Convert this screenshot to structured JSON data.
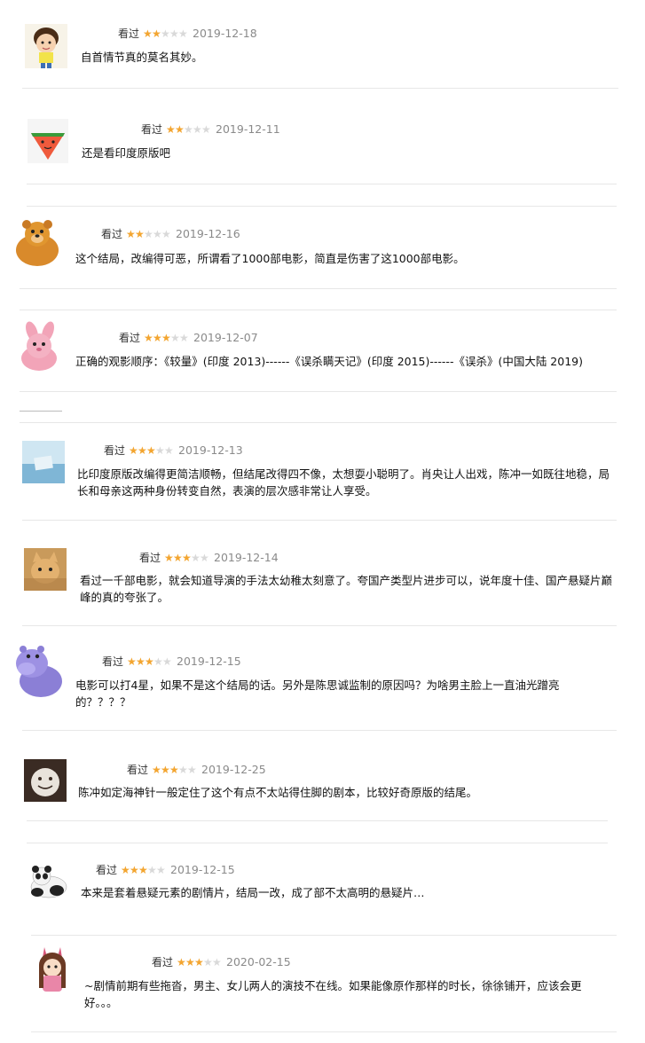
{
  "reviews": [
    {
      "status": "看过",
      "rating": 2,
      "date": "2019-12-18",
      "text": "自首情节真的莫名其妙。"
    },
    {
      "status": "看过",
      "rating": 2,
      "date": "2019-12-11",
      "text": "还是看印度原版吧"
    },
    {
      "status": "看过",
      "rating": 2,
      "date": "2019-12-16",
      "text": "这个结局，改编得可恶，所谓看了1000部电影，简直是伤害了这1000部电影。"
    },
    {
      "status": "看过",
      "rating": 3,
      "date": "2019-12-07",
      "text": "正确的观影顺序：《较量》(印度 2013)------《误杀瞒天记》(印度 2015)------《误杀》(中国大陆 2019)"
    },
    {
      "status": "看过",
      "rating": 3,
      "date": "2019-12-13",
      "text": "比印度原版改编得更简洁顺畅，但结尾改得四不像，太想耍小聪明了。肖央让人出戏，陈冲一如既往地稳，局长和母亲这两种身份转变自然，表演的层次感非常让人享受。"
    },
    {
      "status": "看过",
      "rating": 3,
      "date": "2019-12-14",
      "text": "看过一千部电影，就会知道导演的手法太幼稚太刻意了。夸国产类型片进步可以，说年度十佳、国产悬疑片巅峰的真的夸张了。"
    },
    {
      "status": "看过",
      "rating": 3,
      "date": "2019-12-15",
      "text": "电影可以打4星，如果不是这个结局的话。另外是陈思诚监制的原因吗？为啥男主脸上一直油光蹭亮的？？？？"
    },
    {
      "status": "看过",
      "rating": 3,
      "date": "2019-12-25",
      "text": "陈冲如定海神针一般定住了这个有点不太站得住脚的剧本，比较好奇原版的结尾。"
    },
    {
      "status": "看过",
      "rating": 3,
      "date": "2019-12-15",
      "text": "本来是套着悬疑元素的剧情片，结局一改，成了部不太高明的悬疑片…"
    },
    {
      "status": "看过",
      "rating": 3,
      "date": "2020-02-15",
      "text": "~剧情前期有些拖沓，男主、女儿两人的演技不在线。如果能像原作那样的时长，徐徐铺开，应该会更好。。。"
    }
  ],
  "colors": {
    "star_on": "#f3a530",
    "star_off": "#d9d9d9",
    "separator": "#e7e7e7"
  },
  "avatars": [
    "boy-avatar",
    "watermelon-avatar",
    "bear-avatar",
    "pink-bunny-avatar",
    "landscape-avatar",
    "cat-avatar",
    "purple-hippo-avatar",
    "cookie-avatar",
    "panda-avatar",
    "girl-avatar"
  ]
}
